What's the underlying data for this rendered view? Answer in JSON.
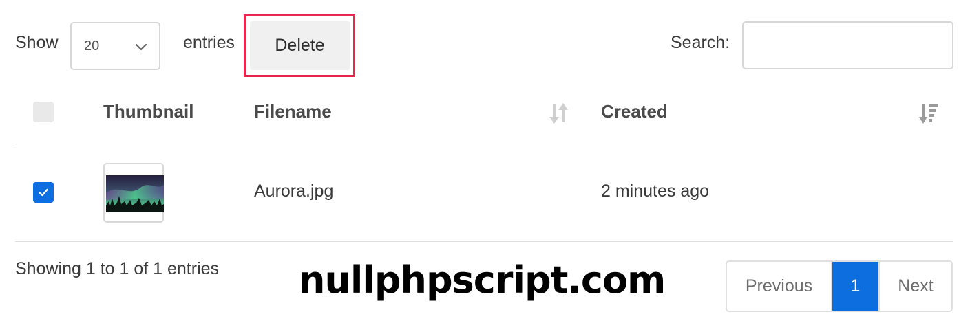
{
  "controls": {
    "show_label": "Show",
    "page_length": "20",
    "entries_label": "entries",
    "delete_label": "Delete",
    "search_label": "Search:",
    "search_value": ""
  },
  "table": {
    "columns": [
      "Thumbnail",
      "Filename",
      "Created"
    ],
    "rows": [
      {
        "selected": true,
        "thumbnail_icon": "aurora-thumbnail",
        "filename": "Aurora.jpg",
        "created": "2 minutes ago"
      }
    ]
  },
  "footer": {
    "info": "Showing 1 to 1 of 1 entries",
    "watermark": "nullphpscript.com",
    "pagination": {
      "previous": "Previous",
      "current": "1",
      "next": "Next"
    }
  },
  "colors": {
    "accent": "#0d6ee0",
    "highlight": "#e8284f"
  }
}
